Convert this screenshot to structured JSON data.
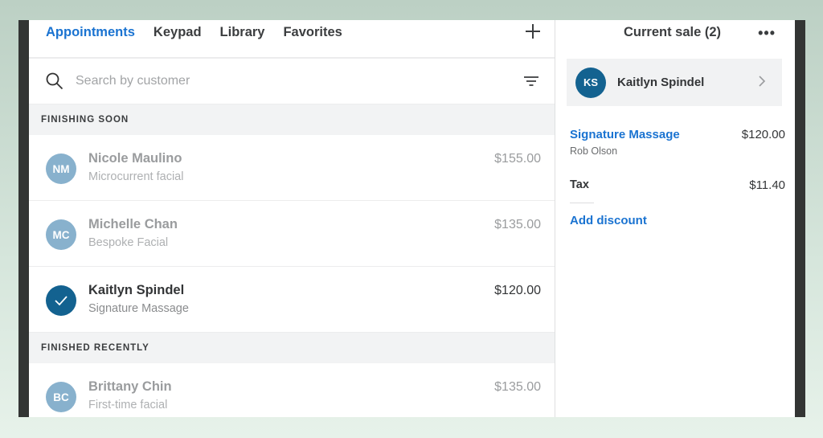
{
  "tabs": [
    {
      "label": "Appointments",
      "active": true
    },
    {
      "label": "Keypad",
      "active": false
    },
    {
      "label": "Library",
      "active": false
    },
    {
      "label": "Favorites",
      "active": false
    }
  ],
  "search": {
    "placeholder": "Search by customer",
    "value": ""
  },
  "sections": {
    "finishing_soon": {
      "title": "FINISHING SOON",
      "rows": [
        {
          "initials": "NM",
          "name": "Nicole Maulino",
          "service": "Microcurrent facial",
          "price": "$155.00",
          "selected": false
        },
        {
          "initials": "MC",
          "name": "Michelle Chan",
          "service": "Bespoke Facial",
          "price": "$135.00",
          "selected": false
        },
        {
          "initials": "",
          "name": "Kaitlyn Spindel",
          "service": "Signature Massage",
          "price": "$120.00",
          "selected": true
        }
      ]
    },
    "finished_recently": {
      "title": "FINISHED RECENTLY",
      "rows": [
        {
          "initials": "BC",
          "name": "Brittany Chin",
          "service": "First-time facial",
          "price": "$135.00",
          "selected": false
        }
      ]
    }
  },
  "sale": {
    "title": "Current sale (2)",
    "more_label": "•••",
    "customer": {
      "initials": "KS",
      "name": "Kaitlyn Spindel"
    },
    "item": {
      "name": "Signature Massage",
      "staff": "Rob Olson",
      "price": "$120.00"
    },
    "tax": {
      "label": "Tax",
      "value": "$11.40"
    },
    "add_discount_label": "Add discount"
  },
  "colors": {
    "accent": "#1a73d1",
    "selected_avatar": "#136290",
    "avatar": "#88b1cd"
  }
}
